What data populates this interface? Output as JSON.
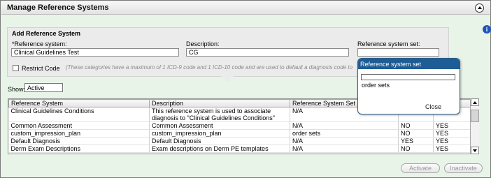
{
  "window": {
    "title": "Manage Reference Systems"
  },
  "add_panel": {
    "heading": "Add Reference System",
    "ref_system_label": "*Reference system:",
    "ref_system_value": "Clinical Guidelines Test",
    "description_label": "Description:",
    "description_value": "CG",
    "ref_set_label": "Reference system set:",
    "ref_set_value": "",
    "restrict_label": "Restrict Code",
    "restrict_note": "(These categories have a maximum of 1 ICD-9 code and 1 ICD-10 code and are used to default a diagnosis code to an"
  },
  "filter": {
    "show_label": "Show:",
    "show_value": "Active"
  },
  "grid": {
    "columns": [
      "Reference System",
      "Description",
      "Reference System Set",
      "",
      ""
    ],
    "rows": [
      [
        "Clinical Guidelines Conditions",
        "This reference system is used to associate diagnosis to \"Clinical Guidelines Conditions\"",
        "N/A",
        "",
        ""
      ],
      [
        "Common Assessment",
        "Common Assessment",
        "N/A",
        "NO",
        "YES"
      ],
      [
        "custom_impression_plan",
        "custom_impression_plan",
        "order sets",
        "NO",
        "YES"
      ],
      [
        "Default Diagnosis",
        "Default Diagnosis",
        "N/A",
        "YES",
        "YES"
      ],
      [
        "Derm Exam Descriptions",
        "Exam descriptions on Derm PE templates",
        "N/A",
        "NO",
        "YES"
      ]
    ]
  },
  "buttons": {
    "activate": "Activate",
    "inactivate": "Inactivate"
  },
  "popup": {
    "title": "Reference system set",
    "search_value": "",
    "item": "order sets",
    "close": "Close"
  },
  "colors": {
    "accent": "#1d5c94",
    "background": "#e9f4e9",
    "info_icon": "#1f55b8"
  },
  "icons": [
    "collapse-icon",
    "info-icon",
    "scroll-up-icon",
    "scroll-down-icon"
  ]
}
